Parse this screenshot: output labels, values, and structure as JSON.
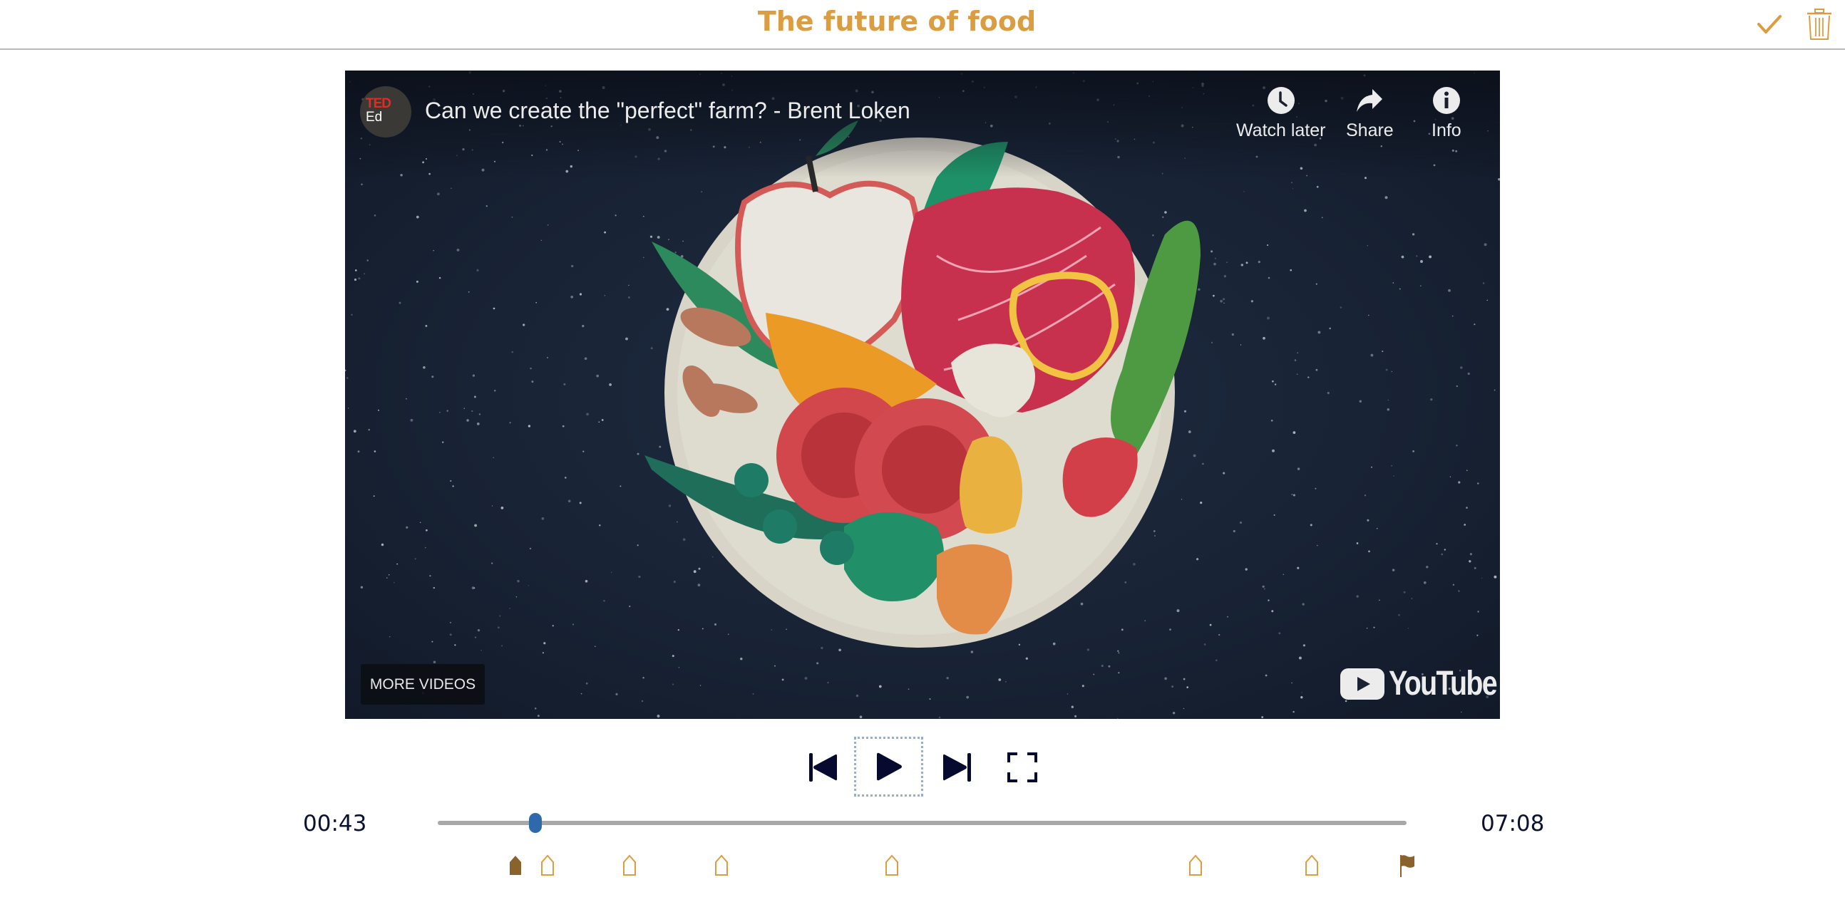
{
  "header": {
    "title": "The future of food",
    "confirm_icon": "checkmark-icon",
    "delete_icon": "trash-icon",
    "accent_color": "#db9d42"
  },
  "video": {
    "channel_logo_top": "TED",
    "channel_logo_bottom": "Ed",
    "title": "Can we create the \"perfect\" farm? - Brent Loken",
    "actions": [
      {
        "label": "Watch later",
        "icon": "clock-icon"
      },
      {
        "label": "Share",
        "icon": "share-arrow-icon"
      },
      {
        "label": "Info",
        "icon": "info-icon"
      }
    ],
    "more_videos_label": "MORE VIDEOS",
    "brand_label": "YouTube"
  },
  "controls": {
    "previous_icon": "skip-previous-icon",
    "play_icon": "play-icon",
    "next_icon": "skip-next-icon",
    "fullscreen_icon": "fullscreen-icon"
  },
  "timeline": {
    "current_time": "00:43",
    "total_time": "07:08",
    "progress_fraction": 0.1005,
    "thumb_color": "#2e6aab",
    "markers": [
      {
        "position": 0.08,
        "type": "filled",
        "color": "#8a622b"
      },
      {
        "position": 0.113,
        "type": "outline",
        "color": "#db9d42"
      },
      {
        "position": 0.198,
        "type": "outline",
        "color": "#db9d42"
      },
      {
        "position": 0.293,
        "type": "outline",
        "color": "#db9d42"
      },
      {
        "position": 0.469,
        "type": "outline",
        "color": "#db9d42"
      },
      {
        "position": 0.782,
        "type": "outline",
        "color": "#db9d42"
      },
      {
        "position": 0.902,
        "type": "outline",
        "color": "#db9d42"
      },
      {
        "position": 1.0,
        "type": "flag",
        "color": "#8a622b"
      }
    ]
  }
}
